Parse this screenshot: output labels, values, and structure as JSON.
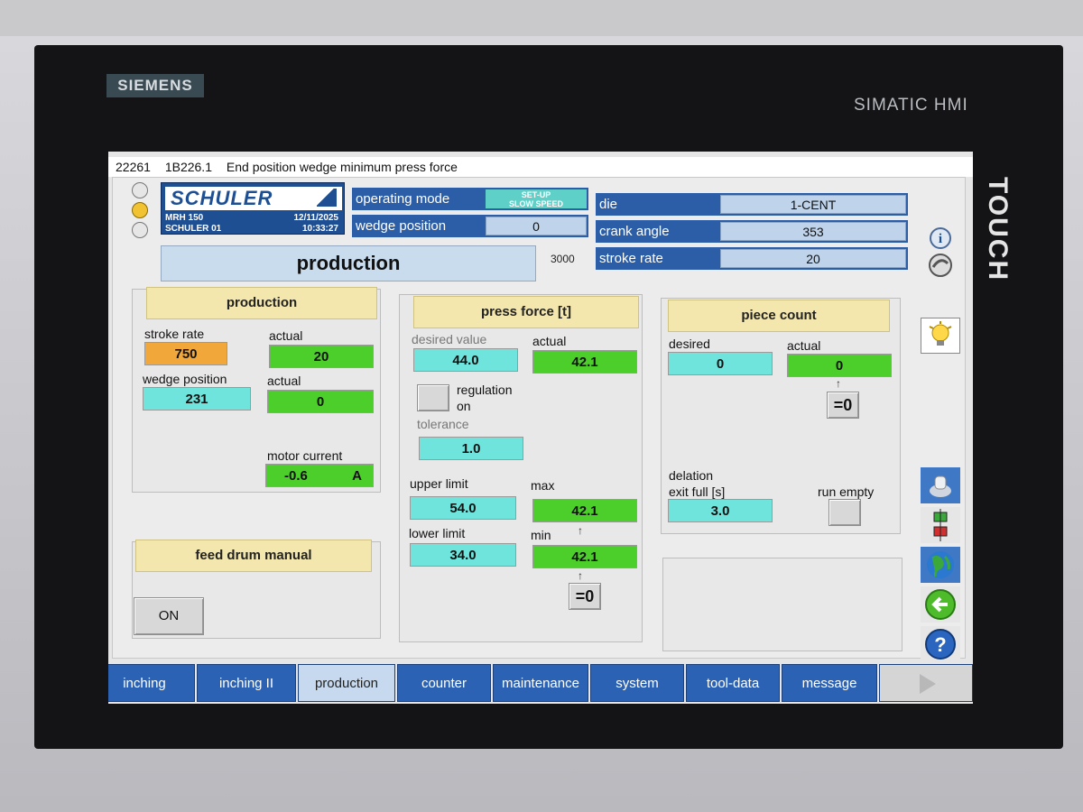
{
  "device": {
    "brand": "SIEMENS",
    "model": "SIMATIC HMI",
    "touch": "TOUCH"
  },
  "message_bar": {
    "code": "22261",
    "id": "1B226.1",
    "text": "End position wedge minimum press force"
  },
  "logo": {
    "word": "SCHULER",
    "machine": "MRH 150",
    "station": "SCHULER 01",
    "date": "12/11/2025",
    "time": "10:33:27"
  },
  "header": {
    "operating_mode_label": "operating mode",
    "operating_mode_value_line1": "SET-UP",
    "operating_mode_value_line2": "SLOW SPEED",
    "wedge_position_label": "wedge position",
    "wedge_position_value": "0",
    "die_label": "die",
    "die_value": "1-CENT",
    "crank_angle_label": "crank angle",
    "crank_angle_value": "353",
    "stroke_rate_label": "stroke rate",
    "stroke_rate_value": "20"
  },
  "page_title": "production",
  "page_number": "3000",
  "production": {
    "header": "production",
    "stroke_rate_label": "stroke rate",
    "stroke_rate_value": "750",
    "stroke_actual_label": "actual",
    "stroke_actual_value": "20",
    "wedge_position_label": "wedge position",
    "wedge_position_value": "231",
    "wedge_actual_label": "actual",
    "wedge_actual_value": "0",
    "motor_current_label": "motor current",
    "motor_current_value": "-0.6",
    "motor_current_unit": "A"
  },
  "feed_drum": {
    "header": "feed drum manual",
    "button": "ON"
  },
  "press_force": {
    "header": "press force [t]",
    "desired_label": "desired value",
    "desired_value": "44.0",
    "actual_label": "actual",
    "actual_value": "42.1",
    "regulation_label_1": "regulation",
    "regulation_label_2": "on",
    "tolerance_label": "tolerance",
    "tolerance_value": "1.0",
    "upper_limit_label": "upper limit",
    "upper_limit_value": "54.0",
    "max_label": "max",
    "max_value": "42.1",
    "lower_limit_label": "lower limit",
    "lower_limit_value": "34.0",
    "min_label": "min",
    "min_value": "42.1",
    "reset_label": "=0"
  },
  "piece_count": {
    "header": "piece count",
    "desired_label": "desired",
    "desired_value": "0",
    "actual_label": "actual",
    "actual_value": "0",
    "reset_label": "=0",
    "delation_label": "delation",
    "exit_full_label": "exit full [s]",
    "exit_full_value": "3.0",
    "run_empty_label": "run empty"
  },
  "side_icons": [
    "info-icon",
    "schuler-emblem-icon",
    "lightbulb-icon",
    "machine-icon",
    "signal-icon",
    "globe-icon",
    "back-arrow-icon",
    "help-icon"
  ],
  "tabs": [
    {
      "label": "inching",
      "state": "normal"
    },
    {
      "label": "inching II",
      "state": "normal"
    },
    {
      "label": "production",
      "state": "active"
    },
    {
      "label": "counter",
      "state": "normal"
    },
    {
      "label": "maintenance",
      "state": "normal"
    },
    {
      "label": "system",
      "state": "normal"
    },
    {
      "label": "tool-data",
      "state": "normal"
    },
    {
      "label": "message",
      "state": "normal"
    }
  ],
  "colors": {
    "header_blue": "#2c5ea8",
    "value_cyan": "#6fe4dc",
    "value_green": "#4ccf2a",
    "value_orange": "#f2a73a",
    "section_yellow": "#f4e7ad"
  }
}
